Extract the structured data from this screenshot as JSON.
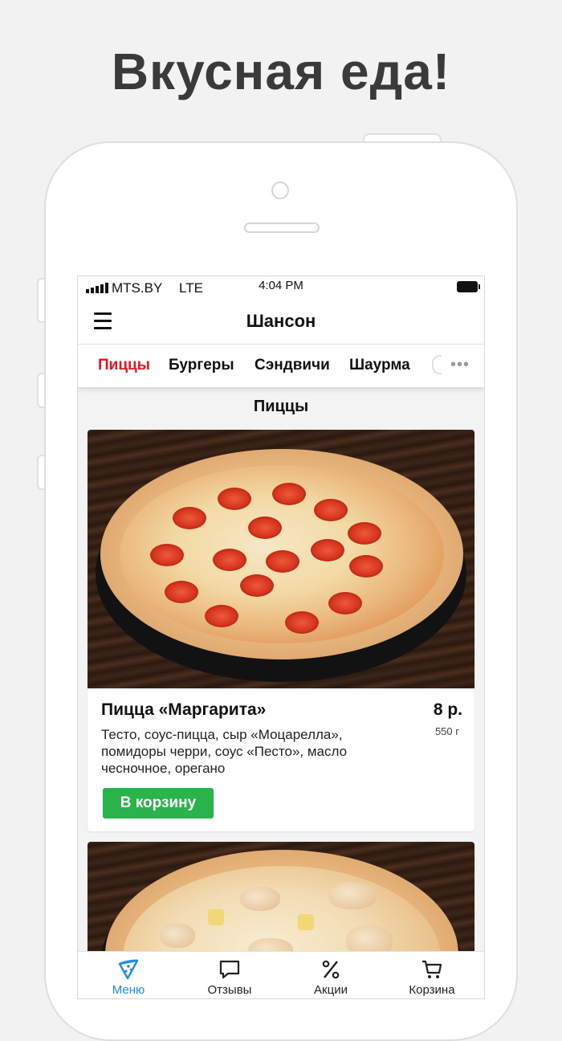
{
  "promo": {
    "headline": "Вкусная еда!"
  },
  "status_bar": {
    "carrier": "MTS.BY",
    "network": "LTE",
    "time": "4:04 PM"
  },
  "navbar": {
    "title": "Шансон"
  },
  "categories": {
    "items": [
      "Пиццы",
      "Бургеры",
      "Сэндвичи",
      "Шаурма"
    ],
    "active": "Пиццы",
    "more_label": "•••"
  },
  "section": {
    "title": "Пиццы"
  },
  "products": [
    {
      "name": "Пицца «Маргарита»",
      "price": "8 р.",
      "weight": "550 г",
      "description": "Тесто, соус-пицца, сыр «Моцарелла», помидоры черри, соус «Песто», масло чесночное, орегано",
      "button_label": "В корзину"
    }
  ],
  "tab_bar": {
    "items": [
      {
        "label": "Меню",
        "icon": "pizza-slice-icon"
      },
      {
        "label": "Отзывы",
        "icon": "chat-bubble-icon"
      },
      {
        "label": "Акции",
        "icon": "percent-icon"
      },
      {
        "label": "Корзина",
        "icon": "cart-icon"
      }
    ],
    "active_color": "#1e8fe0"
  },
  "colors": {
    "accent_active_tab": "#e8151b",
    "button_green": "#2bb34b"
  }
}
